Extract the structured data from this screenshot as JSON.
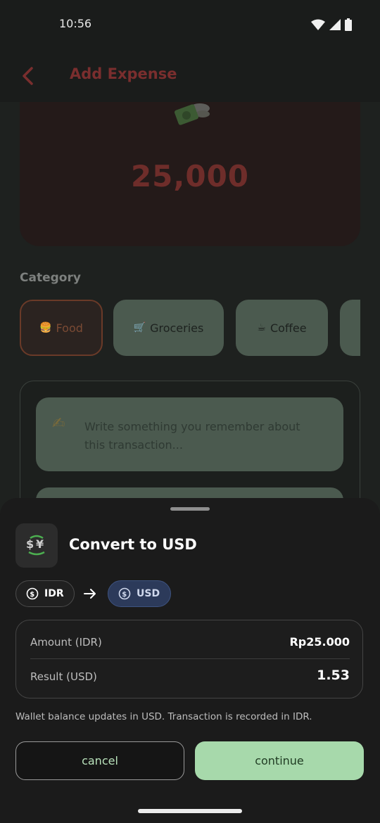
{
  "status_bar": {
    "time": "10:56"
  },
  "app_bar": {
    "title": "Add Expense"
  },
  "amount": {
    "value": "25,000"
  },
  "category": {
    "label": "Category",
    "chips": [
      {
        "icon": "🍔",
        "label": "Food",
        "selected": true
      },
      {
        "icon": "🛒",
        "label": "Groceries",
        "selected": false
      },
      {
        "icon": "☕",
        "label": "Coffee",
        "selected": false
      }
    ]
  },
  "note": {
    "placeholder": "Write something you remember about this transaction..."
  },
  "sheet": {
    "title": "Convert to USD",
    "from_currency": "IDR",
    "to_currency": "USD",
    "rows": [
      {
        "label": "Amount (IDR)",
        "value": "Rp25.000"
      },
      {
        "label": "Result (USD)",
        "value": "1.53"
      }
    ],
    "footnote": "Wallet balance updates in USD. Transaction is recorded in IDR.",
    "cancel_label": "cancel",
    "continue_label": "continue"
  },
  "colors": {
    "accent_red": "#7a2e2e",
    "continue_green": "#a7d9ab",
    "usd_pill": "#2c3a5a"
  }
}
